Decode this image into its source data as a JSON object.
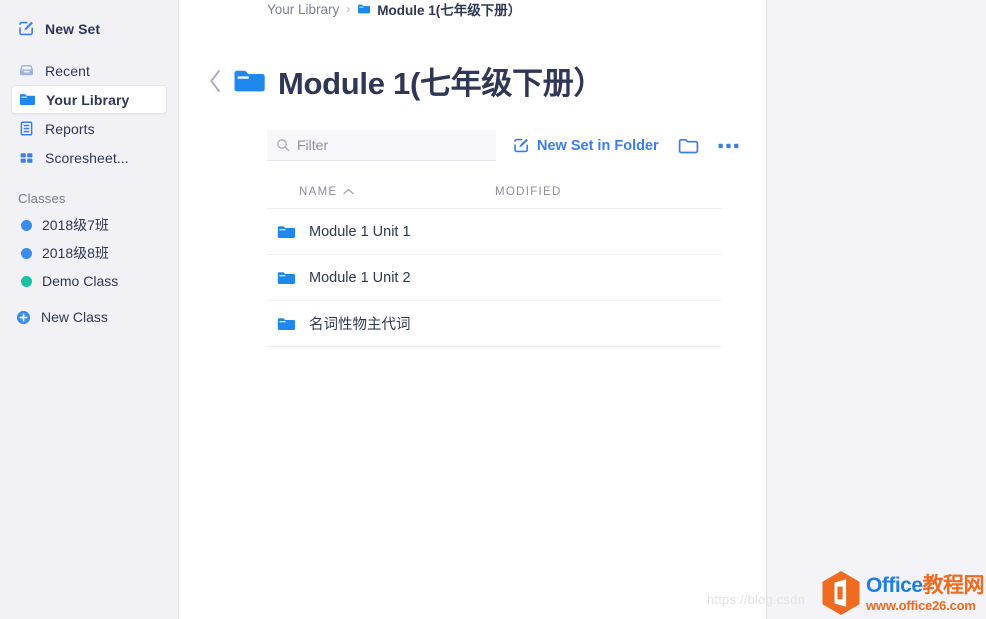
{
  "sidebar": {
    "top_action": {
      "label": "New Set",
      "icon": "edit-square-icon"
    },
    "items": [
      {
        "label": "Recent",
        "icon": "archive-tray-icon",
        "active": false
      },
      {
        "label": "Your Library",
        "icon": "folder-icon",
        "active": true
      },
      {
        "label": "Reports",
        "icon": "report-list-icon",
        "active": false
      },
      {
        "label": "Scoresheet...",
        "icon": "grid-squares-icon",
        "active": false
      }
    ],
    "classes_header": "Classes",
    "classes": [
      {
        "label": "2018级7班",
        "color": "#3b8ded"
      },
      {
        "label": "2018级8班",
        "color": "#3b8ded"
      },
      {
        "label": "Demo Class",
        "color": "#1ec0a4"
      }
    ],
    "new_class": {
      "label": "New Class",
      "icon": "plus-circle-icon"
    }
  },
  "breadcrumb": {
    "root": "Your Library",
    "separator": "›",
    "current": "Module 1(七年级下册）"
  },
  "header": {
    "title": "Module 1(七年级下册）",
    "back_icon": "chevron-left-icon",
    "folder_icon": "open-folder-icon"
  },
  "toolbar": {
    "filter_placeholder": "Filter",
    "filter_value": "",
    "search_icon": "search-icon",
    "new_set_label": "New Set in Folder",
    "new_set_icon": "edit-square-icon",
    "folder_icon": "folder-outline-icon",
    "more_icon": "ellipsis-icon",
    "more_label": "•••"
  },
  "table": {
    "columns": [
      {
        "key": "name",
        "label": "NAME",
        "sorted": true,
        "sort_icon": "chevron-up-icon"
      },
      {
        "key": "modified",
        "label": "MODIFIED",
        "sorted": false
      }
    ],
    "rows": [
      {
        "icon": "folder-icon",
        "name": "Module 1 Unit 1",
        "modified": ""
      },
      {
        "icon": "folder-icon",
        "name": "Module 1 Unit 2",
        "modified": ""
      },
      {
        "icon": "folder-icon",
        "name": "名词性物主代词",
        "modified": ""
      }
    ]
  },
  "watermarks": {
    "csdn": "https://blog.csdn",
    "office_brand_en": "Office",
    "office_brand_cn": "教程网",
    "office_url": "www.office26.com"
  },
  "colors": {
    "accent_blue": "#3b7dea",
    "folder_blue": "#1f88ee",
    "text_dark": "#2e3856",
    "text_muted": "#8a8d9c",
    "sidebar_bg": "#f2f2f6",
    "right_bg": "#f4f3f8",
    "teal": "#1ec0a4",
    "office_orange": "#ef6b1f"
  }
}
